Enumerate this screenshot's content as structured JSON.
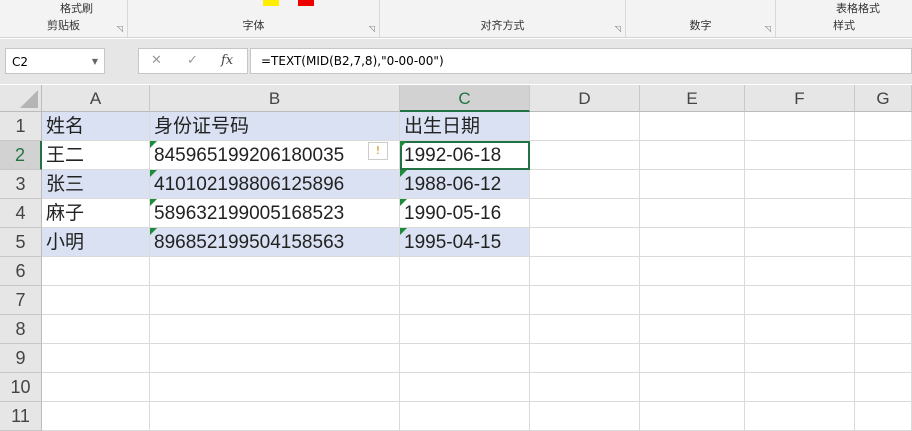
{
  "ribbon": {
    "groups": [
      {
        "label": "剪贴板",
        "top": "格式刷"
      },
      {
        "label": "字体"
      },
      {
        "label": "对齐方式"
      },
      {
        "label": "数字"
      },
      {
        "label": "样式",
        "top": "表格格式"
      }
    ]
  },
  "formula_bar": {
    "name_box": "C2",
    "cancel": "✕",
    "enter": "✓",
    "fx": "fx",
    "formula": "=TEXT(MID(B2,7,8),\"0-00-00\")"
  },
  "columns": [
    "A",
    "B",
    "C",
    "D",
    "E",
    "F",
    "G"
  ],
  "rows": [
    "1",
    "2",
    "3",
    "4",
    "5",
    "6",
    "7",
    "8",
    "9",
    "10",
    "11"
  ],
  "cells": [
    [
      "姓名",
      "身份证号码",
      "出生日期"
    ],
    [
      "王二",
      "845965199206180035",
      "1992-06-18"
    ],
    [
      "张三",
      "410102198806125896",
      "1988-06-12"
    ],
    [
      "麻子",
      "589632199005168523",
      "1990-05-16"
    ],
    [
      "小明",
      "896852199504158563",
      "1995-04-15"
    ]
  ],
  "colors": {
    "band": "#d9e1f2",
    "accent": "#217346"
  }
}
